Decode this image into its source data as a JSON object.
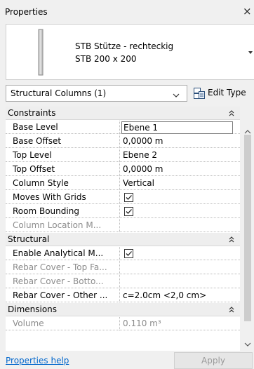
{
  "panel": {
    "title": "Properties",
    "close_glyph": "×"
  },
  "type_selector": {
    "family": "STB Stütze - rechteckig",
    "type": "STB 200 x 200",
    "preview_icon": "column-preview-icon",
    "arrow_icon": "dropdown-arrow-icon"
  },
  "filter": {
    "selected": "Structural Columns (1)",
    "chevron_icon": "chevron-down-icon"
  },
  "edit_type": {
    "label": "Edit Type",
    "icon": "edit-type-icon"
  },
  "sections": {
    "constraints": "Constraints",
    "structural": "Structural",
    "dimensions": "Dimensions"
  },
  "properties": {
    "base_level": {
      "name": "Base Level",
      "value": "Ebene 1"
    },
    "base_offset": {
      "name": "Base Offset",
      "value": "0,0000 m"
    },
    "top_level": {
      "name": "Top Level",
      "value": "Ebene 2"
    },
    "top_offset": {
      "name": "Top Offset",
      "value": "0,0000 m"
    },
    "column_style": {
      "name": "Column Style",
      "value": "Vertical"
    },
    "moves_with_grids": {
      "name": "Moves With Grids",
      "checked": true
    },
    "room_bounding": {
      "name": "Room Bounding",
      "checked": true
    },
    "column_location": {
      "name": "Column Location M...",
      "value": ""
    },
    "enable_analytical": {
      "name": "Enable Analytical M...",
      "checked": true
    },
    "rebar_cover_top": {
      "name": "Rebar Cover - Top Fa...",
      "value": ""
    },
    "rebar_cover_bottom": {
      "name": "Rebar Cover - Botto...",
      "value": ""
    },
    "rebar_cover_other": {
      "name": "Rebar Cover - Other ...",
      "value": "c=2.0cm <2,0 cm>"
    },
    "volume": {
      "name": "Volume",
      "value": "0.110 m³"
    }
  },
  "footer": {
    "help_label": "Properties help",
    "apply_label": "Apply"
  },
  "colors": {
    "link": "#0066cc",
    "section_bg": "#eeeeee",
    "window_bg": "#f0f0f0",
    "disabled_text": "#8c8c8c"
  }
}
